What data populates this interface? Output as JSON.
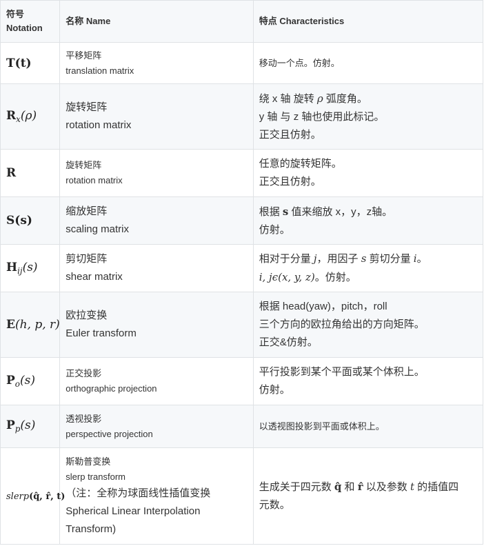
{
  "header": {
    "notation": [
      "符号",
      "Notation"
    ],
    "name": "名称 Name",
    "characteristics": "特点 Characteristics"
  },
  "rows": [
    {
      "symbol": {
        "main": "T",
        "args": "(t)"
      },
      "name": [
        "平移矩阵",
        "translation matrix"
      ],
      "chars": [
        "移动一个点。仿射。"
      ]
    },
    {
      "symbol": {
        "main": "R",
        "sub": "x",
        "args": "(ρ)"
      },
      "name": [
        "旋转矩阵",
        "rotation matrix"
      ],
      "chars": [
        "绕 x 轴 旋转 ",
        "ρ",
        " 弧度角。",
        "y 轴 与 z 轴也使用此标记。",
        "正交且仿射。"
      ]
    },
    {
      "symbol": {
        "main": "R"
      },
      "name": [
        "旋转矩阵",
        "rotation matrix"
      ],
      "chars": [
        "任意的旋转矩阵。",
        "正交且仿射。"
      ]
    },
    {
      "symbol": {
        "main": "S",
        "args": "(s)"
      },
      "name": [
        "缩放矩阵",
        "scaling matrix"
      ],
      "chars": [
        "根据 ",
        "s",
        " 值来缩放 x，y，z轴。",
        "仿射。"
      ]
    },
    {
      "symbol": {
        "main": "H",
        "sub": "ij",
        "args": "(s)"
      },
      "name": [
        "剪切矩阵",
        "shear matrix"
      ],
      "chars": [
        "相对于分量 ",
        "j",
        "，用因子 ",
        "s",
        " 剪切分量 ",
        "i",
        "。",
        "i, jϵ(x, y, z)",
        "。仿射。"
      ]
    },
    {
      "symbol": {
        "main": "E",
        "args": "(h, p, r)"
      },
      "name": [
        "欧拉变换",
        "Euler transform"
      ],
      "chars": [
        "根据 head(yaw)，pitch，roll",
        "三个方向的欧拉角给出的方向矩阵。",
        "正交&仿射。"
      ]
    },
    {
      "symbol": {
        "main": "P",
        "sub": "o",
        "args": "(s)"
      },
      "name": [
        "正交投影",
        "orthographic projection"
      ],
      "chars": [
        "平行投影到某个平面或某个体积上。",
        "仿射。"
      ]
    },
    {
      "symbol": {
        "main": "P",
        "sub": "p",
        "args": "(s)"
      },
      "name": [
        "透视投影",
        "perspective projection"
      ],
      "chars": [
        "以透视图投影到平面或体积上。"
      ]
    },
    {
      "symbol": {
        "main": "slerp",
        "args": "(q̂, r̂, t)"
      },
      "name": [
        "斯勒普变换",
        "slerp transform",
        "（注：全称为球面线性插值变换",
        "Spherical Linear Interpolation",
        "Transform)"
      ],
      "chars": [
        "生成关于四元数 ",
        "q̂",
        " 和 ",
        "r̂",
        " 以及参数 ",
        "t",
        " 的插值四",
        "元数。"
      ]
    }
  ]
}
